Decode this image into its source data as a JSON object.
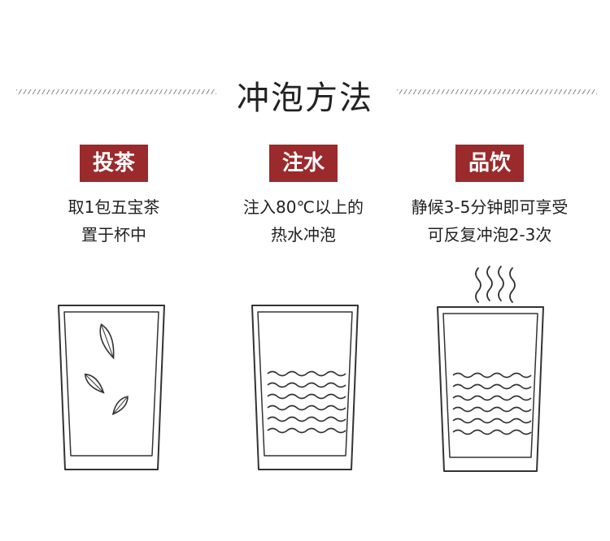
{
  "title": "冲泡方法",
  "accent_color": "#9b2a2c",
  "steps": [
    {
      "badge": "投茶",
      "line1": "取1包五宝茶",
      "line2": "置于杯中",
      "illustration": "cup-with-leaves-icon"
    },
    {
      "badge": "注水",
      "line1": "注入80℃以上的",
      "line2": "热水冲泡",
      "illustration": "cup-with-water-icon"
    },
    {
      "badge": "品饮",
      "line1": "静候3-5分钟即可享受",
      "line2": "可反复冲泡2-3次",
      "illustration": "cup-with-steam-icon"
    }
  ]
}
